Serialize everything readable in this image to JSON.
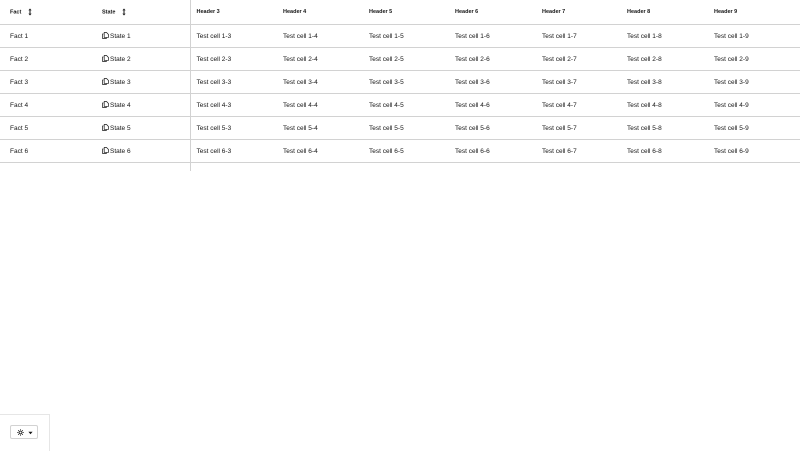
{
  "table": {
    "headers": [
      "Fact",
      "State",
      "Header 3",
      "Header 4",
      "Header 5",
      "Header 6",
      "Header 7",
      "Header 8",
      "Header 9"
    ],
    "rows": [
      {
        "fact": "Fact 1",
        "state": "State 1",
        "cells": [
          "Test cell 1-3",
          "Test cell 1-4",
          "Test cell 1-5",
          "Test cell 1-6",
          "Test cell 1-7",
          "Test cell 1-8",
          "Test cell 1-9"
        ]
      },
      {
        "fact": "Fact 2",
        "state": "State 2",
        "cells": [
          "Test cell 2-3",
          "Test cell 2-4",
          "Test cell 2-5",
          "Test cell 2-6",
          "Test cell 2-7",
          "Test cell 2-8",
          "Test cell 2-9"
        ]
      },
      {
        "fact": "Fact 3",
        "state": "State 3",
        "cells": [
          "Test cell 3-3",
          "Test cell 3-4",
          "Test cell 3-5",
          "Test cell 3-6",
          "Test cell 3-7",
          "Test cell 3-8",
          "Test cell 3-9"
        ]
      },
      {
        "fact": "Fact 4",
        "state": "State 4",
        "cells": [
          "Test cell 4-3",
          "Test cell 4-4",
          "Test cell 4-5",
          "Test cell 4-6",
          "Test cell 4-7",
          "Test cell 4-8",
          "Test cell 4-9"
        ]
      },
      {
        "fact": "Fact 5",
        "state": "State 5",
        "cells": [
          "Test cell 5-3",
          "Test cell 5-4",
          "Test cell 5-5",
          "Test cell 5-6",
          "Test cell 5-7",
          "Test cell 5-8",
          "Test cell 5-9"
        ]
      },
      {
        "fact": "Fact 6",
        "state": "State 6",
        "cells": [
          "Test cell 6-3",
          "Test cell 6-4",
          "Test cell 6-5",
          "Test cell 6-6",
          "Test cell 6-7",
          "Test cell 6-8",
          "Test cell 6-9"
        ]
      }
    ]
  },
  "icons": {
    "sort": "sort-icon",
    "state": "copy-icon",
    "theme": "sun-icon",
    "dropdown": "caret-down-icon"
  },
  "colors": {
    "border": "#d2d2d2",
    "text": "#151515"
  }
}
